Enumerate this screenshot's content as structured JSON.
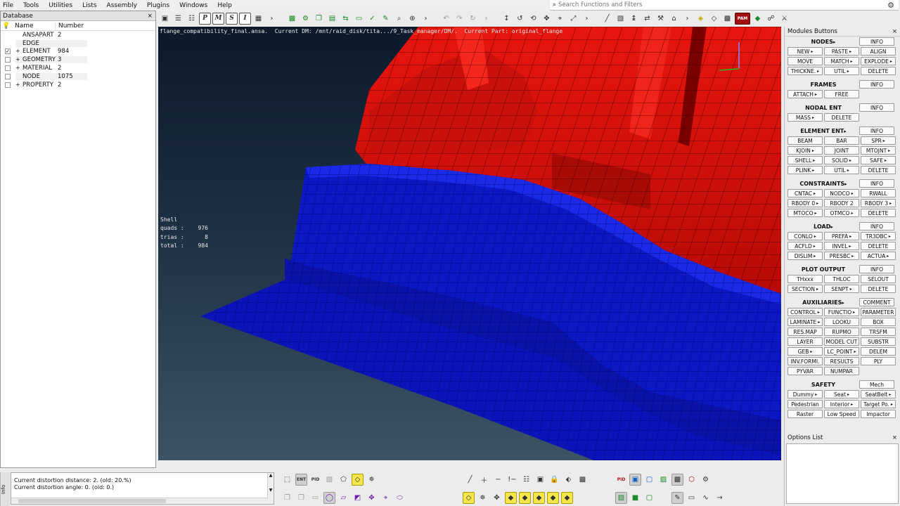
{
  "menubar": {
    "items": [
      "File",
      "Tools",
      "Utilities",
      "Lists",
      "Assembly",
      "Plugins",
      "Windows",
      "Help"
    ]
  },
  "search": {
    "placeholder": "Search Functions and Filters"
  },
  "database": {
    "title": "Database",
    "col_name": "Name",
    "col_number": "Number",
    "rows": [
      {
        "name": "ANSAPART",
        "number": "2",
        "checked": "",
        "expand": ""
      },
      {
        "name": "EDGE",
        "number": "",
        "checked": "",
        "expand": ""
      },
      {
        "name": "ELEMENT",
        "number": "984",
        "checked": "✓",
        "expand": "+"
      },
      {
        "name": "GEOMETRY",
        "number": "3",
        "checked": "",
        "expand": "+"
      },
      {
        "name": "MATERIAL",
        "number": "2",
        "checked": "",
        "expand": "+"
      },
      {
        "name": "NODE",
        "number": "1075",
        "checked": "",
        "expand": ""
      },
      {
        "name": "PROPERTY",
        "number": "2",
        "checked": "",
        "expand": "+"
      }
    ]
  },
  "viewport": {
    "info": "flange_compatibility_final.ansa.  Current DM: /mnt/raid_disk/tita.../9_Task_manager/DM/.  Current Part: original_flange",
    "shell_title": "Shell",
    "stats": [
      {
        "key": "quads :",
        "value": "976"
      },
      {
        "key": "trias :",
        "value": "8"
      },
      {
        "key": "total :",
        "value": "984"
      }
    ],
    "colors": {
      "red_part": "#d8120c",
      "blue_part": "#0a14c8"
    }
  },
  "modules": {
    "title": "Modules Buttons",
    "sections": [
      {
        "head": "NODES",
        "arrow": true,
        "info": "INFO",
        "rows": [
          [
            "NEW",
            "PASTE",
            "ALIGN"
          ],
          [
            "MOVE",
            "MATCH",
            "EXPLODE"
          ],
          [
            "THICKNE.",
            "UTIL",
            "DELETE"
          ]
        ],
        "arrows": [
          [
            1,
            1,
            0
          ],
          [
            0,
            1,
            1
          ],
          [
            1,
            1,
            0
          ]
        ]
      },
      {
        "head": "FRAMES",
        "arrow": false,
        "info": "INFO",
        "rows": [
          [
            "ATTACH",
            "FREE"
          ]
        ],
        "arrows": [
          [
            1,
            0
          ]
        ]
      },
      {
        "head": "NODAL ENT",
        "arrow": false,
        "info": "INFO",
        "rows": [
          [
            "MASS",
            "DELETE"
          ]
        ],
        "arrows": [
          [
            1,
            0
          ]
        ]
      },
      {
        "head": "ELEMENT ENT",
        "arrow": true,
        "info": "INFO",
        "rows": [
          [
            "BEAM",
            "BAR",
            "SPR"
          ],
          [
            "KJOIN",
            "JOINT",
            "MTOJNT"
          ],
          [
            "SHELL",
            "SOLID",
            "SAFE"
          ],
          [
            "PLINK",
            "UTIL",
            "DELETE"
          ]
        ],
        "arrows": [
          [
            0,
            0,
            1
          ],
          [
            1,
            0,
            1
          ],
          [
            1,
            1,
            1
          ],
          [
            1,
            1,
            0
          ]
        ]
      },
      {
        "head": "CONSTRAINTS",
        "arrow": true,
        "info": "INFO",
        "rows": [
          [
            "CNTAC",
            "NODCO",
            "RWALL"
          ],
          [
            "RBODY 0",
            "RBODY 2",
            "RBODY 3"
          ],
          [
            "MTOCO",
            "OTMCO",
            "DELETE"
          ]
        ],
        "arrows": [
          [
            1,
            1,
            0
          ],
          [
            1,
            0,
            1
          ],
          [
            1,
            1,
            0
          ]
        ]
      },
      {
        "head": "LOAD",
        "arrow": true,
        "info": "INFO",
        "rows": [
          [
            "CONLO",
            "PREFA",
            "TR3DBC"
          ],
          [
            "ACFLD",
            "INVEL",
            "DELETE"
          ],
          [
            "DISLIM",
            "PRESBC",
            "ACTUA"
          ]
        ],
        "arrows": [
          [
            1,
            1,
            1
          ],
          [
            1,
            1,
            0
          ],
          [
            1,
            1,
            1
          ]
        ]
      },
      {
        "head": "PLOT OUTPUT",
        "arrow": false,
        "info": "INFO",
        "rows": [
          [
            "THxxx",
            "THLOC",
            "SELOUT"
          ],
          [
            "SECTION",
            "SENPT",
            "DELETE"
          ]
        ],
        "arrows": [
          [
            0,
            0,
            0
          ],
          [
            1,
            1,
            0
          ]
        ]
      },
      {
        "head": "AUXILIARIES",
        "arrow": true,
        "info": "COMMENT",
        "rows": [
          [
            "CONTROL",
            "FUNCTIO",
            "PARAMETER"
          ],
          [
            "LAMINATE",
            "LOOKU",
            "BOX"
          ],
          [
            "RES.MAP",
            "RUPMO",
            "TRSFM"
          ],
          [
            "LAYER",
            "MODEL CUT",
            "SUBSTR"
          ],
          [
            "GEB",
            "LC_POINT",
            "DELEM"
          ],
          [
            "INV.FORMI.",
            "RESULTS",
            "PLY"
          ],
          [
            "PYVAR",
            "NUMPAR"
          ]
        ],
        "arrows": [
          [
            1,
            1,
            0
          ],
          [
            1,
            0,
            0
          ],
          [
            0,
            0,
            0
          ],
          [
            0,
            0,
            0
          ],
          [
            1,
            1,
            0
          ],
          [
            0,
            0,
            0
          ],
          [
            0,
            0
          ]
        ]
      },
      {
        "head": "SAFETY",
        "arrow": false,
        "info": "Mech",
        "rows": [
          [
            "Dummy",
            "Seat",
            "SeatBelt"
          ],
          [
            "Pedestrian",
            "Interior",
            "Target Po."
          ],
          [
            "Raster",
            "Low Speed",
            "Impactor"
          ]
        ],
        "arrows": [
          [
            1,
            1,
            1
          ],
          [
            0,
            1,
            1
          ],
          [
            0,
            0,
            0
          ]
        ]
      }
    ]
  },
  "options": {
    "title": "Options List"
  },
  "console": {
    "lines": [
      "Current distortion distance: 2. (old: 20.%)",
      "Current distortion angle: 0. (old: 0.)"
    ],
    "info_tab": "Info"
  },
  "bottom_toolbar": {
    "ent_label": "ENT",
    "pid_label": "PID"
  }
}
